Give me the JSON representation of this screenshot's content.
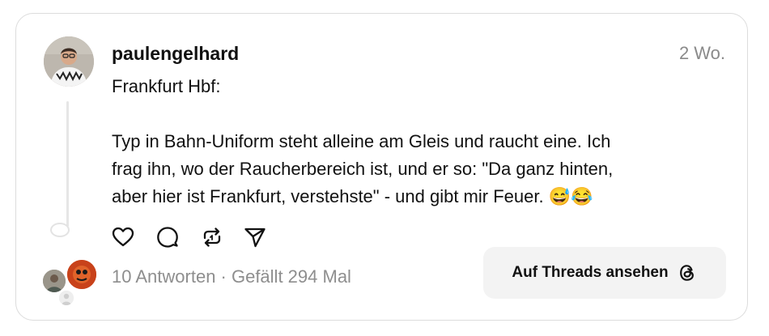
{
  "post": {
    "username": "paulengelhard",
    "time": "2 Wo.",
    "text_lines": [
      "Frankfurt Hbf:",
      "Typ in Bahn-Uniform steht alleine am Gleis und raucht eine. Ich",
      "frag ihn, wo der Raucherbereich ist, und er so: \"Da ganz hinten,",
      "aber hier ist Frankfurt, verstehste\" - und gibt mir Feuer. 😅😂"
    ],
    "stats": "10 Antworten · Gefällt 294 Mal",
    "cta_label": "Auf Threads ansehen"
  },
  "icons": {
    "like": "heart-icon",
    "reply": "comment-icon",
    "repost": "repost-icon",
    "share": "send-icon",
    "brand": "threads-logo-icon"
  },
  "colors": {
    "text": "#111111",
    "muted": "#8e8e8e",
    "border": "#dcdcdc",
    "button_bg": "#f3f3f3"
  }
}
